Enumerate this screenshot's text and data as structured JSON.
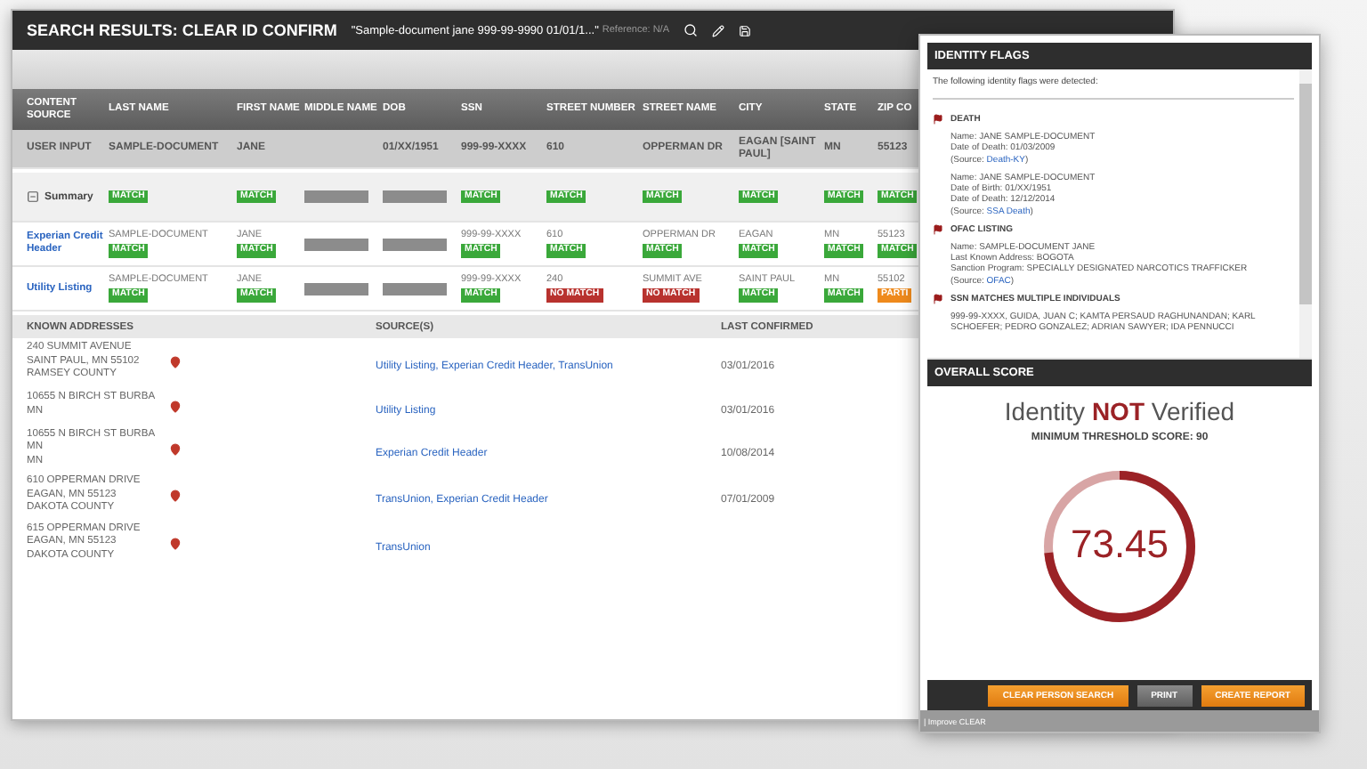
{
  "search_header": {
    "title": "SEARCH RESULTS: CLEAR ID CONFIRM",
    "query": "\"Sample-document jane 999-99-9990 01/01/1...\"",
    "reference": "Reference: N/A"
  },
  "comparison_table": {
    "columns": [
      "CONTENT SOURCE",
      "LAST NAME",
      "FIRST NAME",
      "MIDDLE NAME",
      "DOB",
      "SSN",
      "STREET NUMBER",
      "STREET NAME",
      "CITY",
      "STATE",
      "ZIP CO"
    ],
    "rows": [
      {
        "kind": "input",
        "cells": [
          {
            "kind": "text",
            "text": "USER INPUT"
          },
          {
            "kind": "text",
            "text": "SAMPLE-DOCUMENT"
          },
          {
            "kind": "text",
            "text": "JANE"
          },
          {
            "kind": "blank"
          },
          {
            "kind": "text",
            "text": "01/XX/1951"
          },
          {
            "kind": "text",
            "text": "999-99-XXXX"
          },
          {
            "kind": "text",
            "text": "610"
          },
          {
            "kind": "text",
            "text": "OPPERMAN DR"
          },
          {
            "kind": "text",
            "text": "EAGAN [SAINT PAUL]"
          },
          {
            "kind": "text",
            "text": "MN"
          },
          {
            "kind": "text",
            "text": "55123"
          }
        ]
      },
      {
        "kind": "summary",
        "cells": [
          {
            "kind": "toggle",
            "text": "Summary",
            "expanded": true
          },
          {
            "kind": "badge",
            "color": "#3aa83a",
            "label": "MATCH"
          },
          {
            "kind": "badge",
            "color": "#3aa83a",
            "label": "MATCH"
          },
          {
            "kind": "redacted"
          },
          {
            "kind": "redacted"
          },
          {
            "kind": "badge",
            "color": "#3aa83a",
            "label": "MATCH"
          },
          {
            "kind": "badge",
            "color": "#3aa83a",
            "label": "MATCH"
          },
          {
            "kind": "badge",
            "color": "#3aa83a",
            "label": "MATCH"
          },
          {
            "kind": "badge",
            "color": "#3aa83a",
            "label": "MATCH"
          },
          {
            "kind": "badge",
            "color": "#3aa83a",
            "label": "MATCH"
          },
          {
            "kind": "badge",
            "color": "#3aa83a",
            "label": "MATCH"
          }
        ]
      },
      {
        "kind": "source",
        "cells": [
          {
            "kind": "link",
            "text": "Experian Credit Header"
          },
          {
            "kind": "text",
            "text": "SAMPLE-DOCUMENT",
            "color": "#3aa83a",
            "label": "MATCH"
          },
          {
            "kind": "text",
            "text": "JANE",
            "color": "#3aa83a",
            "label": "MATCH"
          },
          {
            "kind": "redacted"
          },
          {
            "kind": "redacted"
          },
          {
            "kind": "text",
            "text": "999-99-XXXX",
            "color": "#3aa83a",
            "label": "MATCH"
          },
          {
            "kind": "text",
            "text": "610",
            "color": "#3aa83a",
            "label": "MATCH"
          },
          {
            "kind": "text",
            "text": "OPPERMAN DR",
            "color": "#3aa83a",
            "label": "MATCH"
          },
          {
            "kind": "text",
            "text": "EAGAN",
            "color": "#3aa83a",
            "label": "MATCH"
          },
          {
            "kind": "text",
            "text": "MN",
            "color": "#3aa83a",
            "label": "MATCH"
          },
          {
            "kind": "text",
            "text": "55123",
            "color": "#3aa83a",
            "label": "MATCH"
          }
        ]
      },
      {
        "kind": "source",
        "cells": [
          {
            "kind": "link",
            "text": "Utility Listing"
          },
          {
            "kind": "text",
            "text": "SAMPLE-DOCUMENT",
            "color": "#3aa83a",
            "label": "MATCH"
          },
          {
            "kind": "text",
            "text": "JANE",
            "color": "#3aa83a",
            "label": "MATCH"
          },
          {
            "kind": "redacted"
          },
          {
            "kind": "redacted"
          },
          {
            "kind": "text",
            "text": "999-99-XXXX",
            "color": "#3aa83a",
            "label": "MATCH"
          },
          {
            "kind": "text",
            "text": "240",
            "color": "#b8322e",
            "label": "NO MATCH"
          },
          {
            "kind": "text",
            "text": "SUMMIT AVE",
            "color": "#b8322e",
            "label": "NO MATCH"
          },
          {
            "kind": "text",
            "text": "SAINT PAUL",
            "color": "#3aa83a",
            "label": "MATCH"
          },
          {
            "kind": "text",
            "text": "MN",
            "color": "#3aa83a",
            "label": "MATCH"
          },
          {
            "kind": "text",
            "text": "55102",
            "color": "#ef8a1c",
            "label": "PARTI"
          }
        ]
      }
    ]
  },
  "known_addresses": {
    "columns": [
      "KNOWN ADDRESSES",
      "SOURCE(S)",
      "LAST CONFIRMED"
    ],
    "rows": [
      {
        "lines": [
          "240 SUMMIT AVENUE",
          "SAINT PAUL, MN 55102",
          "RAMSEY COUNTY"
        ],
        "sources": "Utility Listing, Experian Credit Header, TransUnion",
        "confirmed": "03/01/2016"
      },
      {
        "lines": [
          "10655 N BIRCH ST BURBA",
          "MN"
        ],
        "sources": "Utility Listing",
        "confirmed": "03/01/2016"
      },
      {
        "lines": [
          "10655 N BIRCH ST BURBA MN",
          "MN"
        ],
        "sources": "Experian Credit Header",
        "confirmed": "10/08/2014"
      },
      {
        "lines": [
          "610 OPPERMAN DRIVE",
          "EAGAN, MN 55123",
          "DAKOTA COUNTY"
        ],
        "sources": "TransUnion, Experian Credit Header",
        "confirmed": "07/01/2009"
      },
      {
        "lines": [
          "615 OPPERMAN DRIVE",
          "EAGAN, MN 55123",
          "DAKOTA COUNTY"
        ],
        "sources": "TransUnion"
      }
    ]
  },
  "identity_flags": {
    "title": "IDENTITY FLAGS",
    "intro": "The following identity flags were detected:",
    "flags": [
      {
        "title": "DEATH",
        "entries": [
          {
            "lines": [
              "Name: JANE SAMPLE-DOCUMENT",
              "Date of Death: 01/03/2009"
            ],
            "source_prefix": "(Source: ",
            "source": "Death-KY",
            "source_suffix": ")"
          },
          {
            "lines": [
              "Name: JANE SAMPLE-DOCUMENT",
              "Date of Birth: 01/XX/1951",
              "Date of Death: 12/12/2014"
            ],
            "source_prefix": "(Source: ",
            "source": "SSA Death",
            "source_suffix": ")"
          }
        ]
      },
      {
        "title": "OFAC LISTING",
        "entries": [
          {
            "lines": [
              "Name: SAMPLE-DOCUMENT JANE",
              "Last Known Address: BOGOTA",
              "Sanction Program: SPECIALLY DESIGNATED NARCOTICS TRAFFICKER"
            ],
            "source_prefix": "(Source: ",
            "source": "OFAC",
            "source_suffix": ")"
          }
        ]
      },
      {
        "title": "SSN MATCHES MULTIPLE INDIVIDUALS",
        "entries": [
          {
            "lines": [
              "999-99-XXXX, GUIDA, JUAN C; KAMTA PERSAUD RAGHUNANDAN; KARL SCHOEFER; PEDRO GONZALEZ; ADRIAN SAWYER; IDA PENNUCCI"
            ]
          }
        ]
      }
    ]
  },
  "overall_score": {
    "title": "OVERALL SCORE",
    "verdict": "Identity **NOT** Verified",
    "threshold": "MINIMUM THRESHOLD SCORE: 90",
    "score": "73.45",
    "level": 0.7345
  },
  "actions": [
    {
      "label": "CLEAR PERSON SEARCH",
      "kind": "primary"
    },
    {
      "label": "PRINT",
      "kind": "secondary"
    },
    {
      "label": "CREATE REPORT",
      "kind": "primary"
    }
  ],
  "footer_link": "| Improve CLEAR"
}
